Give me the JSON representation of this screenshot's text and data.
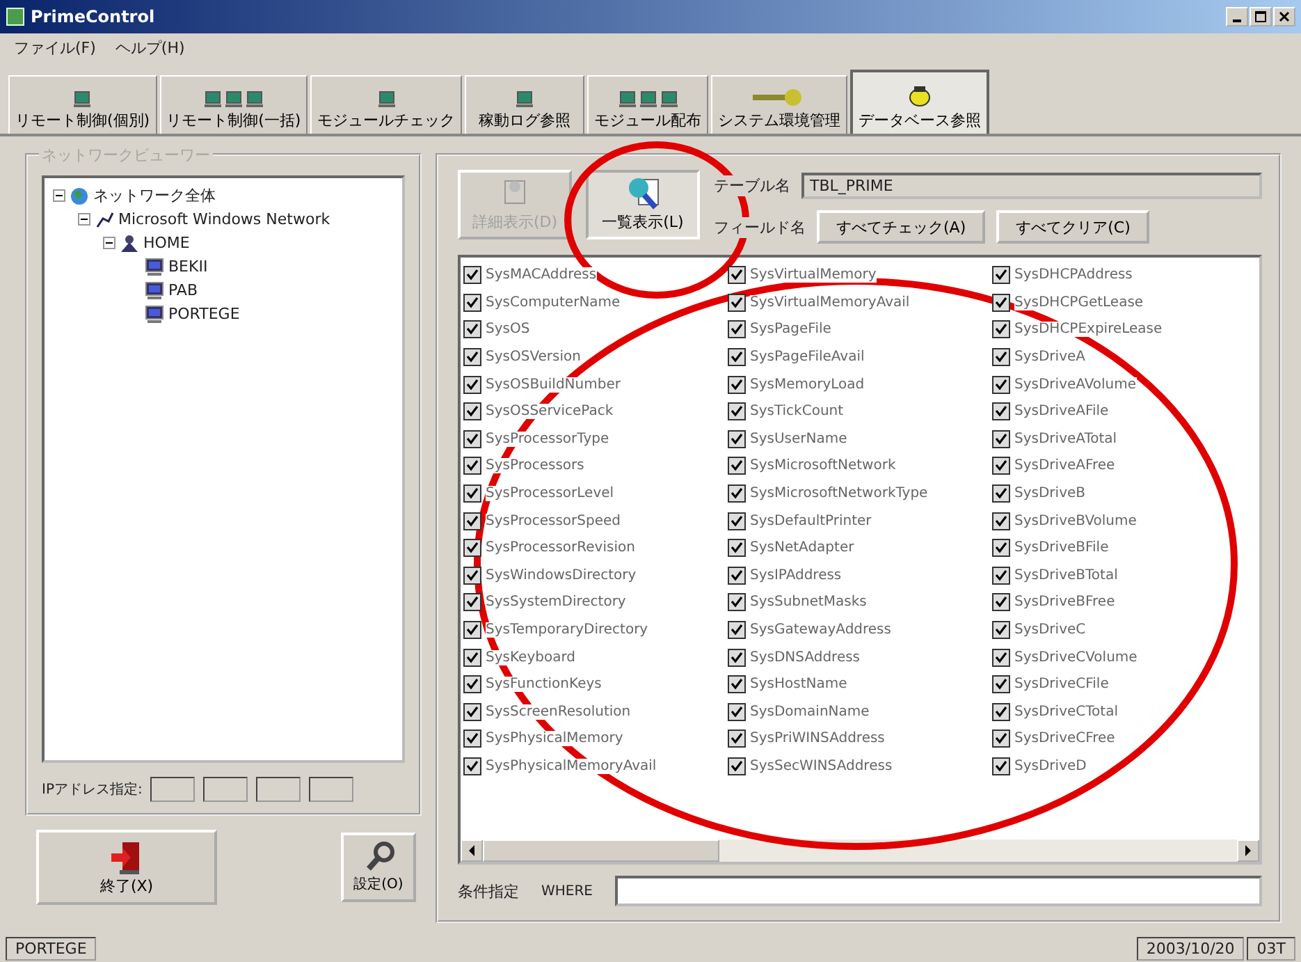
{
  "window": {
    "title": "PrimeControl"
  },
  "menu": [
    "ファイル(F)",
    "ヘルプ(H)"
  ],
  "tabs": [
    {
      "label": "リモート制御(個別)",
      "kind": "single",
      "selected": false
    },
    {
      "label": "リモート制御(一括)",
      "kind": "multi",
      "selected": false
    },
    {
      "label": "モジュールチェック",
      "kind": "single",
      "selected": false
    },
    {
      "label": "稼動ログ参照",
      "kind": "single",
      "selected": false
    },
    {
      "label": "モジュール配布",
      "kind": "multi",
      "selected": false
    },
    {
      "label": "システム環境管理",
      "kind": "key",
      "selected": false
    },
    {
      "label": "データベース参照",
      "kind": "db",
      "selected": true
    }
  ],
  "network_panel": {
    "title": "ネットワークビューワー",
    "tree": [
      {
        "label": "ネットワーク全体",
        "kind": "globe",
        "expanded": true,
        "children": [
          {
            "label": "Microsoft Windows Network",
            "kind": "network",
            "expanded": true,
            "children": [
              {
                "label": "HOME",
                "kind": "group",
                "expanded": true,
                "children": [
                  {
                    "label": "BEKII",
                    "kind": "computer"
                  },
                  {
                    "label": "PAB",
                    "kind": "computer"
                  },
                  {
                    "label": "PORTEGE",
                    "kind": "computer"
                  }
                ]
              }
            ]
          }
        ]
      }
    ],
    "ip_label": "IPアドレス指定:"
  },
  "exit_button": "終了(X)",
  "settings_button": "設定(O)",
  "db_panel": {
    "detail_button": {
      "label": "詳細表示(D)",
      "disabled": true
    },
    "list_button": {
      "label": "一覧表示(L)",
      "disabled": false
    },
    "table_label": "テーブル名",
    "table_value": "TBL_PRIME",
    "field_label": "フィールド名",
    "check_all": "すべてチェック(A)",
    "clear_all": "すべてクリア(C)",
    "fields": [
      {
        "label": "SysMACAddress",
        "checked": true
      },
      {
        "label": "SysComputerName",
        "checked": true
      },
      {
        "label": "SysOS",
        "checked": true
      },
      {
        "label": "SysOSVersion",
        "checked": true
      },
      {
        "label": "SysOSBuildNumber",
        "checked": true
      },
      {
        "label": "SysOSServicePack",
        "checked": true
      },
      {
        "label": "SysProcessorType",
        "checked": true
      },
      {
        "label": "SysProcessors",
        "checked": true
      },
      {
        "label": "SysProcessorLevel",
        "checked": true
      },
      {
        "label": "SysProcessorSpeed",
        "checked": true
      },
      {
        "label": "SysProcessorRevision",
        "checked": true
      },
      {
        "label": "SysWindowsDirectory",
        "checked": true
      },
      {
        "label": "SysSystemDirectory",
        "checked": true
      },
      {
        "label": "SysTemporaryDirectory",
        "checked": true
      },
      {
        "label": "SysKeyboard",
        "checked": true
      },
      {
        "label": "SysFunctionKeys",
        "checked": true
      },
      {
        "label": "SysScreenResolution",
        "checked": true
      },
      {
        "label": "SysPhysicalMemory",
        "checked": true
      },
      {
        "label": "SysPhysicalMemoryAvail",
        "checked": true
      },
      {
        "label": "SysVirtualMemory",
        "checked": true
      },
      {
        "label": "SysVirtualMemoryAvail",
        "checked": true
      },
      {
        "label": "SysPageFile",
        "checked": true
      },
      {
        "label": "SysPageFileAvail",
        "checked": true
      },
      {
        "label": "SysMemoryLoad",
        "checked": true
      },
      {
        "label": "SysTickCount",
        "checked": true
      },
      {
        "label": "SysUserName",
        "checked": true
      },
      {
        "label": "SysMicrosoftNetwork",
        "checked": true
      },
      {
        "label": "SysMicrosoftNetworkType",
        "checked": true
      },
      {
        "label": "SysDefaultPrinter",
        "checked": true
      },
      {
        "label": "SysNetAdapter",
        "checked": true
      },
      {
        "label": "SysIPAddress",
        "checked": true
      },
      {
        "label": "SysSubnetMasks",
        "checked": true
      },
      {
        "label": "SysGatewayAddress",
        "checked": true
      },
      {
        "label": "SysDNSAddress",
        "checked": true
      },
      {
        "label": "SysHostName",
        "checked": true
      },
      {
        "label": "SysDomainName",
        "checked": true
      },
      {
        "label": "SysPriWINSAddress",
        "checked": true
      },
      {
        "label": "SysSecWINSAddress",
        "checked": true
      },
      {
        "label": "SysDHCPAddress",
        "checked": true
      },
      {
        "label": "SysDHCPGetLease",
        "checked": true
      },
      {
        "label": "SysDHCPExpireLease",
        "checked": true
      },
      {
        "label": "SysDriveA",
        "checked": true
      },
      {
        "label": "SysDriveAVolume",
        "checked": true
      },
      {
        "label": "SysDriveAFile",
        "checked": true
      },
      {
        "label": "SysDriveATotal",
        "checked": true
      },
      {
        "label": "SysDriveAFree",
        "checked": true
      },
      {
        "label": "SysDriveB",
        "checked": true
      },
      {
        "label": "SysDriveBVolume",
        "checked": true
      },
      {
        "label": "SysDriveBFile",
        "checked": true
      },
      {
        "label": "SysDriveBTotal",
        "checked": true
      },
      {
        "label": "SysDriveBFree",
        "checked": true
      },
      {
        "label": "SysDriveC",
        "checked": true
      },
      {
        "label": "SysDriveCVolume",
        "checked": true
      },
      {
        "label": "SysDriveCFile",
        "checked": true
      },
      {
        "label": "SysDriveCTotal",
        "checked": true
      },
      {
        "label": "SysDriveCFree",
        "checked": true
      },
      {
        "label": "SysDriveD",
        "checked": true
      }
    ],
    "condition_label": "条件指定",
    "where_label": "WHERE"
  },
  "status_bar": [
    "PORTEGE",
    "2003/10/20",
    "03T"
  ]
}
